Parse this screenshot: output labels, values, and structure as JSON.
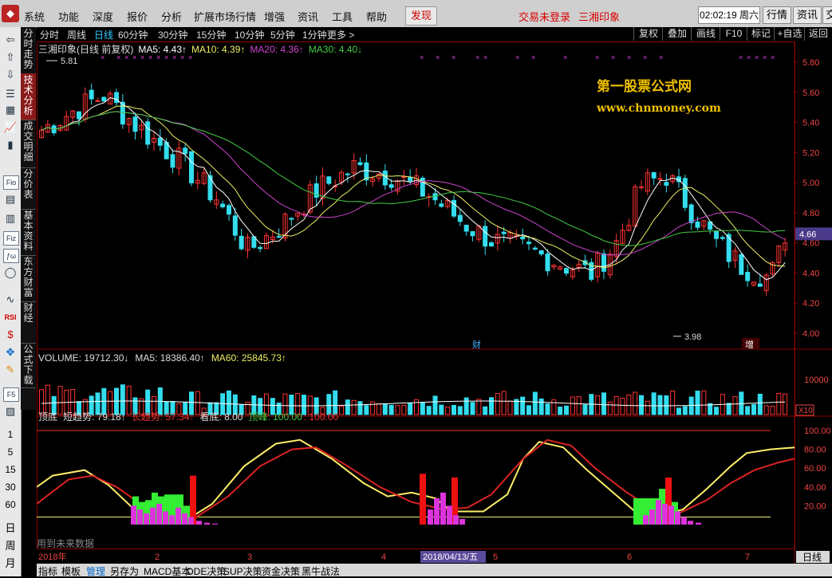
{
  "menubar": {
    "items": [
      "系统",
      "功能",
      "深度",
      "报价",
      "分析",
      "扩展市场行情",
      "增强",
      "资讯",
      "工具",
      "帮助"
    ],
    "discover": "发现",
    "login_status": "交易未登录",
    "stock_name": "三湘印象",
    "clock": "02:02:19 周六",
    "right_buttons": [
      "行情",
      "资讯",
      "交"
    ]
  },
  "left_toolbar": {
    "icons": [
      "back-arrow-icon",
      "up-arrow-icon",
      "down-arrow-icon",
      "list-icon",
      "grid-icon",
      "line-chart-icon",
      "candle-chart-icon",
      "f10-icon",
      "document-icon",
      "fund-icon",
      "finance-icon",
      "formula-icon",
      "circle-icon",
      "wave-icon",
      "rsi-icon",
      "dollar-icon",
      "move-icon",
      "pencil-icon",
      "f5-icon",
      "image-icon"
    ],
    "icon_glyphs": [
      "⇦",
      "⇧",
      "⇩",
      "☰",
      "▦",
      "📈",
      "▮",
      "Fio",
      "▤",
      "▥",
      "Fiz",
      "ƒω",
      "◯",
      "∿",
      "RSI",
      "$",
      "✥",
      "✎",
      "F5",
      "▨"
    ],
    "numbers": [
      "1",
      "5",
      "15",
      "30",
      "60"
    ],
    "periods": [
      "日",
      "周",
      "月"
    ]
  },
  "vertical_tabs": [
    "分时走势",
    "技术分析",
    "成交明细",
    "分价表",
    "基本资料",
    "东方财富",
    "财经",
    "公式下载"
  ],
  "period_bar": {
    "items": [
      "分时",
      "周线",
      "日线",
      "60分钟",
      "30分钟",
      "15分钟",
      "10分钟",
      "5分钟",
      "1分钟",
      "更多 >"
    ],
    "selected": "日线",
    "right": [
      "复权",
      "叠加",
      "画线",
      "F10",
      "标记",
      "+自选",
      "返回"
    ]
  },
  "price_panel": {
    "title": "三湘印象(日线 前复权)",
    "ma5": "MA5: 4.43↑",
    "ma10": "MA10: 4.39↑",
    "ma20": "MA20: 4.36↑",
    "ma30": "MA30: 4.40↓",
    "high_label": "5.81",
    "low_label": "3.98",
    "current_price": "4.66",
    "y_ticks": [
      "5.80",
      "5.60",
      "5.40",
      "5.20",
      "5.00",
      "4.80",
      "4.60",
      "4.40",
      "4.20",
      "4.00"
    ],
    "watermark1": "第一股票公式网",
    "watermark2": "www.chnmoney.com",
    "marker_cai": "财",
    "marker_zeng": "增"
  },
  "volume_panel": {
    "volume": "VOLUME: 19712.30↓",
    "ma5": "MA5: 18386.40↑",
    "ma60": "MA60: 25845.73↑",
    "y_tick": "10000",
    "unit": "X10"
  },
  "indicator_panel": {
    "name": "顶底",
    "short_trend": "短趋势: 79.18↑",
    "long_trend": "长趋势: 57.34↑",
    "bottom": "看底: 8.00",
    "top": "顶峰: 100.00",
    "top2": ": 100.00",
    "y_ticks": [
      "100.00",
      "80.00",
      "60.00",
      "40.00",
      "20.00"
    ],
    "note": "用到未来数据"
  },
  "xaxis": {
    "labels": [
      "2018年",
      "2",
      "3",
      "4",
      "5",
      "6",
      "7"
    ],
    "cursor_date": "2018/04/13/五",
    "period": "日线"
  },
  "bottom_tabs": [
    "指标",
    "模板",
    "管理",
    "另存为",
    "MACD基本",
    "DDE决策",
    "SUP决策",
    "资金决策",
    "黑牛战法"
  ],
  "bottom_selected": "管理",
  "colors": {
    "up": "#ff3333",
    "down": "#33ddee",
    "ma5": "#ffffff",
    "ma10": "#eeee66",
    "ma20": "#cc44cc",
    "ma30": "#44cc44",
    "short_trend": "#ffee66",
    "long_trend": "#dd2222",
    "bar_green": "#33ee33",
    "bar_magenta": "#dd33dd"
  }
}
